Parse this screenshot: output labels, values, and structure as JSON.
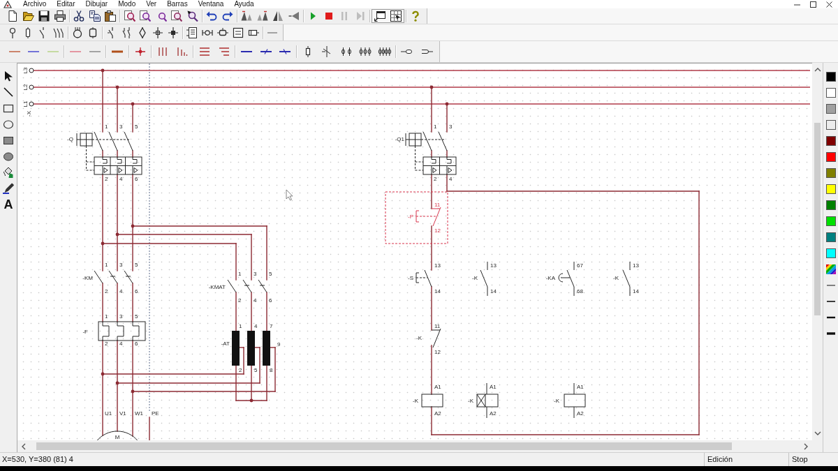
{
  "menu": [
    "Archivo",
    "Editar",
    "Dibujar",
    "Modo",
    "Ver",
    "Barras",
    "Ventana",
    "Ayuda"
  ],
  "toolbar": {
    "simulation_controls": [
      {
        "kind": "play",
        "disabled": false
      },
      {
        "kind": "stop",
        "disabled": false
      },
      {
        "kind": "pause",
        "disabled": true
      },
      {
        "kind": "step",
        "disabled": true
      }
    ]
  },
  "tool_palette": {
    "text_tool": "A"
  },
  "schematic": {
    "supply": {
      "terminals": [
        "L3",
        "L2",
        "L1"
      ],
      "tag": "-X"
    },
    "power_circuit": [
      {
        "kind": "breaker",
        "tag": "-Q",
        "terminals": [
          "1",
          "3",
          "5",
          "2",
          "4",
          "6"
        ],
        "selected": false
      },
      {
        "kind": "contactor",
        "tag": "-KM",
        "terminals": [
          "1",
          "3",
          "5",
          "2",
          "4",
          "6"
        ],
        "selected": false
      },
      {
        "kind": "contactor",
        "tag": "-KMAT",
        "terminals": [
          "1",
          "3",
          "5",
          "2",
          "4",
          "6"
        ],
        "selected": false
      },
      {
        "kind": "overload_relay",
        "tag": "-F",
        "terminals": [
          "1",
          "3",
          "5",
          "2",
          "4",
          "6"
        ],
        "selected": false
      },
      {
        "kind": "autotransformer",
        "tag": "-AT",
        "terminals": [
          "1",
          "4",
          "7",
          "2",
          "5",
          "8",
          "9"
        ],
        "selected": false
      },
      {
        "kind": "motor",
        "symbol": "M",
        "terminals": [
          "U1",
          "V1",
          "W1",
          "PE"
        ],
        "selected": false
      }
    ],
    "control_circuit": [
      {
        "kind": "breaker",
        "tag": "-Q1",
        "terminals": [
          "1",
          "3",
          "2",
          "4"
        ],
        "selected": false
      },
      {
        "kind": "pushbutton_nc",
        "tag": "-P",
        "terminals": [
          "11",
          "12"
        ],
        "selected": true
      },
      {
        "kind": "pushbutton_no",
        "tag": "-S",
        "terminals": [
          "13",
          "14"
        ],
        "selected": false
      },
      {
        "kind": "no_contact",
        "tag": "-K",
        "terminals": [
          "13",
          "14"
        ],
        "selected": false
      },
      {
        "kind": "timer_no_contact",
        "tag": "-KA",
        "terminals": [
          "67",
          "68"
        ],
        "selected": false
      },
      {
        "kind": "no_contact",
        "tag": "-K",
        "terminals": [
          "13",
          "14"
        ],
        "selected": false
      },
      {
        "kind": "nc_contact",
        "tag": "-K",
        "terminals": [
          "11",
          "12"
        ],
        "selected": false
      },
      {
        "kind": "coil",
        "tag": "-K",
        "terminals": [
          "A1",
          "A2"
        ],
        "selected": false
      },
      {
        "kind": "delay_coil",
        "tag": "-K",
        "terminals": [
          "A1",
          "A2"
        ],
        "selected": false
      },
      {
        "kind": "coil",
        "tag": "-K",
        "terminals": [
          "A1",
          "A2"
        ],
        "selected": false
      }
    ]
  },
  "color_palette": [
    {
      "color": "#000000"
    },
    {
      "color": "#ffffff"
    },
    {
      "color": "#a0a0a0"
    },
    {
      "color": "#ececec"
    },
    {
      "color": "#800000"
    },
    {
      "color": "#ff0000"
    },
    {
      "color": "#808000"
    },
    {
      "color": "#ffff00"
    },
    {
      "color": "#008000"
    },
    {
      "color": "#00e000"
    },
    {
      "color": "#008080"
    },
    {
      "color": "#00ffff"
    }
  ],
  "status_bar": {
    "coordinates": "X=530, Y=380 (81) 4",
    "mode": "Edición",
    "simulation": "Stop"
  }
}
